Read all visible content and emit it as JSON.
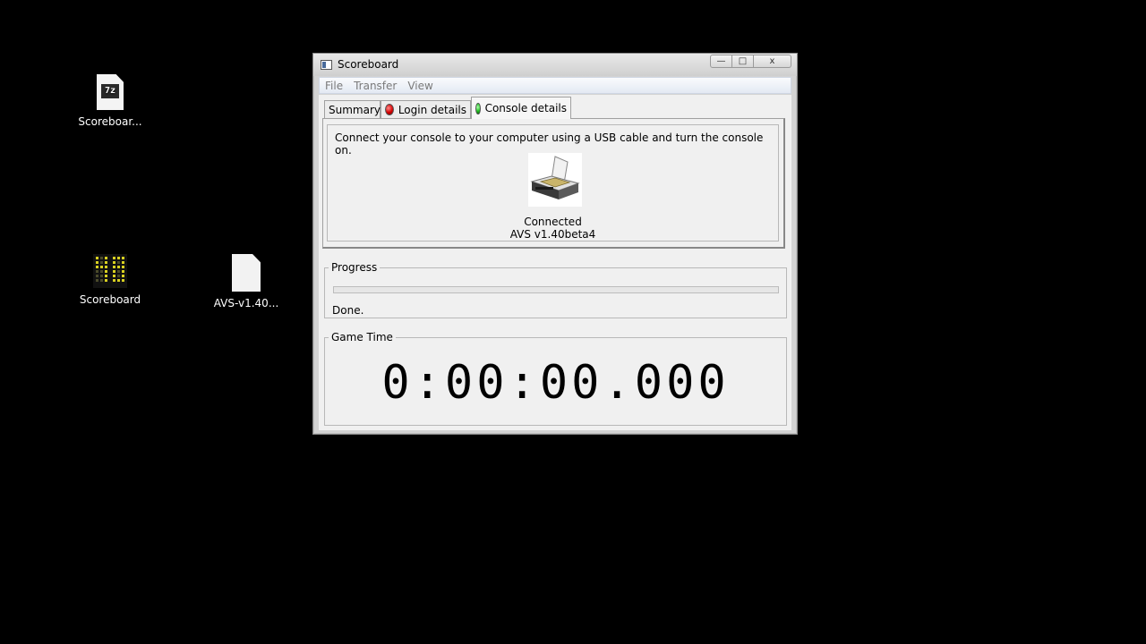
{
  "desktop": {
    "icons": [
      {
        "label": "Scoreboar...",
        "icon": "7z-archive-icon",
        "badge": "7z"
      },
      {
        "label": "Scoreboard",
        "icon": "scoreboard-app-icon"
      },
      {
        "label": "AVS-v1.40...",
        "icon": "blank-file-icon"
      }
    ]
  },
  "window": {
    "title": "Scoreboard",
    "buttons": {
      "minimize": "—",
      "maximize": "□",
      "close": "x"
    },
    "menu": [
      "File",
      "Transfer",
      "View"
    ],
    "tabs": [
      {
        "label": "Summary",
        "status": null
      },
      {
        "label": "Login details",
        "status": "red"
      },
      {
        "label": "Console details",
        "status": "green",
        "active": true
      }
    ],
    "console_details": {
      "instructions": "Connect your console to your computer using a USB cable and turn the console on.",
      "status": "Connected",
      "version": "AVS v1.40beta4"
    },
    "progress": {
      "legend": "Progress",
      "value": 0,
      "status_text": "Done."
    },
    "game_time": {
      "legend": "Game Time",
      "value": "0:00:00.000"
    }
  },
  "colors": {
    "desktop_bg": "#000000",
    "status_red": "#d40000",
    "status_green": "#22c422"
  }
}
